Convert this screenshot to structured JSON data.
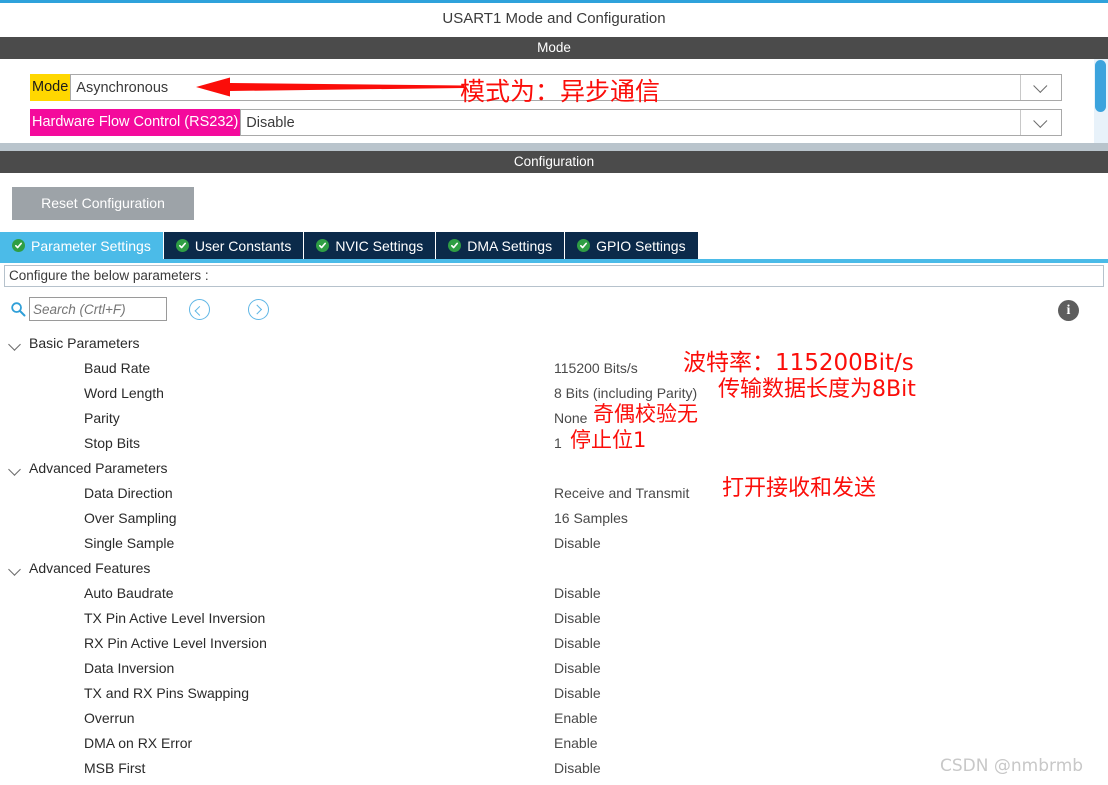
{
  "window": {
    "title": "USART1 Mode and Configuration"
  },
  "mode_section": {
    "header": "Mode",
    "rows": [
      {
        "label": "Mode",
        "value": "Asynchronous",
        "highlight": "#ffd700"
      },
      {
        "label": "Hardware Flow Control (RS232)",
        "value": "Disable",
        "highlight": "#f40a9c"
      }
    ],
    "chevron_icon": "chevron-down-icon"
  },
  "configuration_section": {
    "header": "Configuration",
    "reset_button": "Reset Configuration",
    "tabs": [
      {
        "label": "Parameter Settings",
        "active": true,
        "icon": "green-check-icon"
      },
      {
        "label": "User Constants",
        "active": false,
        "icon": "green-check-icon"
      },
      {
        "label": "NVIC Settings",
        "active": false,
        "icon": "green-check-icon"
      },
      {
        "label": "DMA Settings",
        "active": false,
        "icon": "green-check-icon"
      },
      {
        "label": "GPIO Settings",
        "active": false,
        "icon": "green-check-icon"
      }
    ],
    "notice": "Configure the below parameters :",
    "search": {
      "placeholder": "Search (Crtl+F)",
      "value": "",
      "icon": "search-icon",
      "prev_icon": "circle-left-arrow-icon",
      "next_icon": "circle-right-arrow-icon"
    },
    "info_icon": "info-icon",
    "info_glyph": "i"
  },
  "parameters": [
    {
      "type": "group",
      "name": "Basic Parameters"
    },
    {
      "type": "item",
      "name": "Baud Rate",
      "value": "115200 Bits/s"
    },
    {
      "type": "item",
      "name": "Word Length",
      "value": "8 Bits (including Parity)"
    },
    {
      "type": "item",
      "name": "Parity",
      "value": "None"
    },
    {
      "type": "item",
      "name": "Stop Bits",
      "value": "1"
    },
    {
      "type": "group",
      "name": "Advanced Parameters"
    },
    {
      "type": "item",
      "name": "Data Direction",
      "value": "Receive and Transmit"
    },
    {
      "type": "item",
      "name": "Over Sampling",
      "value": "16 Samples"
    },
    {
      "type": "item",
      "name": "Single Sample",
      "value": "Disable"
    },
    {
      "type": "group",
      "name": "Advanced Features"
    },
    {
      "type": "item",
      "name": "Auto Baudrate",
      "value": "Disable"
    },
    {
      "type": "item",
      "name": "TX Pin Active Level Inversion",
      "value": "Disable"
    },
    {
      "type": "item",
      "name": "RX Pin Active Level Inversion",
      "value": "Disable"
    },
    {
      "type": "item",
      "name": "Data Inversion",
      "value": "Disable"
    },
    {
      "type": "item",
      "name": "TX and RX Pins Swapping",
      "value": "Disable"
    },
    {
      "type": "item",
      "name": "Overrun",
      "value": "Enable"
    },
    {
      "type": "item",
      "name": "DMA on RX Error",
      "value": "Enable"
    },
    {
      "type": "item",
      "name": "MSB First",
      "value": "Disable"
    }
  ],
  "annotations": {
    "color": "#fb0d09",
    "mode": "模式为：异步通信",
    "baud_rate": "波特率：115200Bit/s",
    "word_length": "传输数据长度为8Bit",
    "parity": "奇偶校验无",
    "stop_bits": "停止位1",
    "data_direction": "打开接收和发送",
    "arrow_icon": "red-left-arrow-icon"
  },
  "watermark": "CSDN @nmbrmb",
  "colors": {
    "accent_blue": "#2fa2db",
    "tab_active": "#4bbbe8",
    "tab_inactive": "#0b2a4a",
    "header_bar": "#4b4b4b",
    "check_green": "#2f9e44",
    "scrollbar_thumb": "#3ba3dd"
  }
}
